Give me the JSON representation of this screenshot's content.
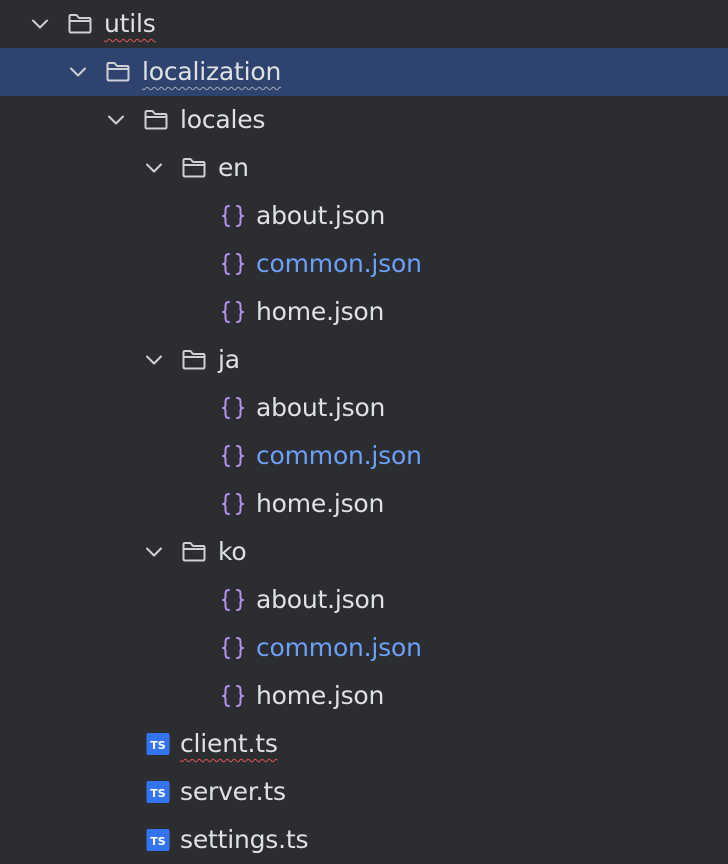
{
  "colors": {
    "background": "#2b2d30",
    "selection": "#2e436e",
    "text": "#dfe1e5",
    "modified_text": "#6c9ff5",
    "json_icon": "#b592f0",
    "ts_icon": "#3574f0",
    "error_underline": "#e05555"
  },
  "tree": {
    "utils": {
      "label": "utils",
      "icon": "folder-icon",
      "expanded": true
    },
    "localization": {
      "label": "localization",
      "icon": "folder-icon",
      "expanded": true,
      "selected": true
    },
    "locales": {
      "label": "locales",
      "icon": "folder-icon",
      "expanded": true
    },
    "en": {
      "label": "en",
      "icon": "folder-icon",
      "expanded": true,
      "files": [
        {
          "label": "about.json",
          "icon": "json-file-icon",
          "modified": false
        },
        {
          "label": "common.json",
          "icon": "json-file-icon",
          "modified": true
        },
        {
          "label": "home.json",
          "icon": "json-file-icon",
          "modified": false
        }
      ]
    },
    "ja": {
      "label": "ja",
      "icon": "folder-icon",
      "expanded": true,
      "files": [
        {
          "label": "about.json",
          "icon": "json-file-icon",
          "modified": false
        },
        {
          "label": "common.json",
          "icon": "json-file-icon",
          "modified": true
        },
        {
          "label": "home.json",
          "icon": "json-file-icon",
          "modified": false
        }
      ]
    },
    "ko": {
      "label": "ko",
      "icon": "folder-icon",
      "expanded": true,
      "files": [
        {
          "label": "about.json",
          "icon": "json-file-icon",
          "modified": false
        },
        {
          "label": "common.json",
          "icon": "json-file-icon",
          "modified": true
        },
        {
          "label": "home.json",
          "icon": "json-file-icon",
          "modified": false
        }
      ]
    },
    "ts_files": [
      {
        "label": "client.ts",
        "icon": "typescript-file-icon",
        "badge": "TS",
        "has_error": true
      },
      {
        "label": "server.ts",
        "icon": "typescript-file-icon",
        "badge": "TS",
        "has_error": false
      },
      {
        "label": "settings.ts",
        "icon": "typescript-file-icon",
        "badge": "TS",
        "has_error": false
      }
    ]
  }
}
